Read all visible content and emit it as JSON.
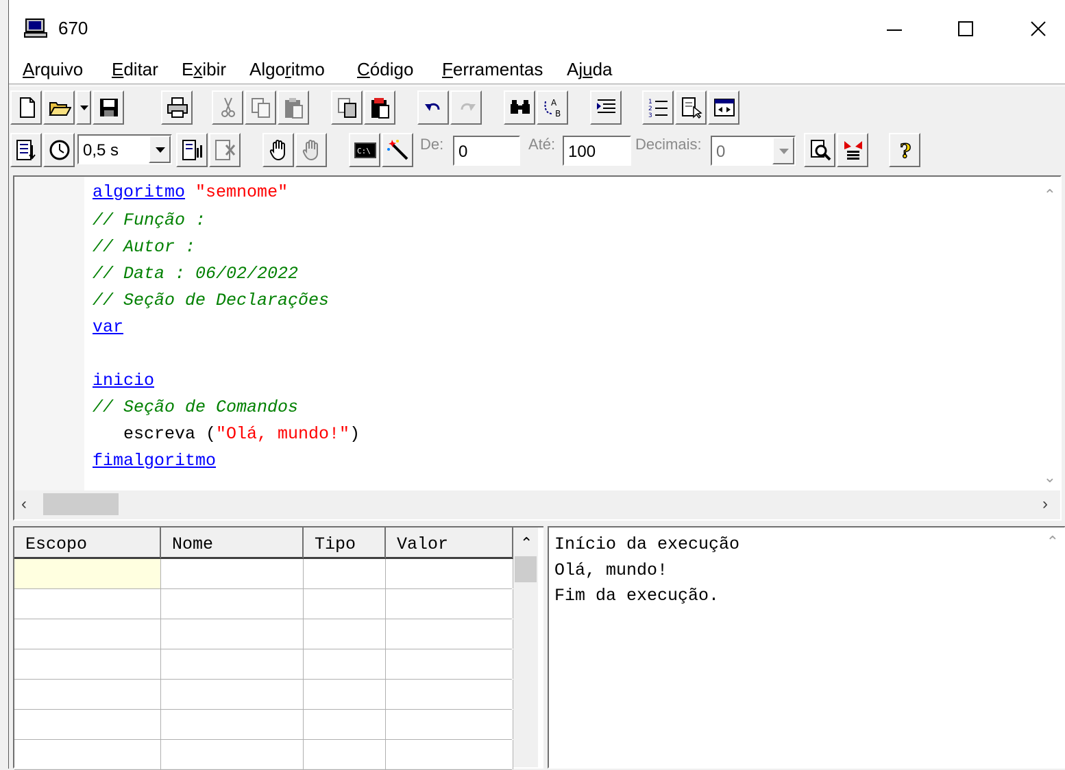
{
  "window": {
    "title": "670"
  },
  "menu": [
    {
      "pre": "",
      "acc": "A",
      "post": "rquivo"
    },
    {
      "pre": "",
      "acc": "E",
      "post": "ditar"
    },
    {
      "pre": "E",
      "acc": "x",
      "post": "ibir"
    },
    {
      "pre": "Algo",
      "acc": "r",
      "post": "itmo"
    },
    {
      "pre": "",
      "acc": "C",
      "post": "ódigo"
    },
    {
      "pre": "",
      "acc": "F",
      "post": "erramentas"
    },
    {
      "pre": "Aj",
      "acc": "u",
      "post": "da"
    }
  ],
  "toolbar": {
    "speed": "0,5 s",
    "de_label": "De:",
    "de_value": "0",
    "ate_label": "Até:",
    "ate_value": "100",
    "decimais_label": "Decimais:",
    "decimais_value": "0"
  },
  "editor": {
    "lines": [
      [
        {
          "t": "algoritmo",
          "c": "kw"
        },
        {
          "t": " ",
          "c": "plain"
        },
        {
          "t": "\"semnome\"",
          "c": "str"
        }
      ],
      [
        {
          "t": "// Função :",
          "c": "cmt"
        }
      ],
      [
        {
          "t": "// Autor :",
          "c": "cmt"
        }
      ],
      [
        {
          "t": "// Data : 06/02/2022",
          "c": "cmt"
        }
      ],
      [
        {
          "t": "// Seção de Declarações",
          "c": "cmt"
        }
      ],
      [
        {
          "t": "var",
          "c": "kw"
        }
      ],
      [
        {
          "t": "",
          "c": "plain"
        }
      ],
      [
        {
          "t": "inicio",
          "c": "kw"
        }
      ],
      [
        {
          "t": "// Seção de Comandos",
          "c": "cmt"
        }
      ],
      [
        {
          "t": "   escreva (",
          "c": "plain"
        },
        {
          "t": "\"Olá, mundo!\"",
          "c": "str"
        },
        {
          "t": ")",
          "c": "plain"
        }
      ],
      [
        {
          "t": "fimalgoritmo",
          "c": "kw"
        }
      ]
    ]
  },
  "variables": {
    "headers": [
      "Escopo",
      "Nome",
      "Tipo",
      "Valor"
    ]
  },
  "output": {
    "lines": [
      "Início da execução",
      "Olá, mundo!",
      "Fim da execução."
    ]
  }
}
